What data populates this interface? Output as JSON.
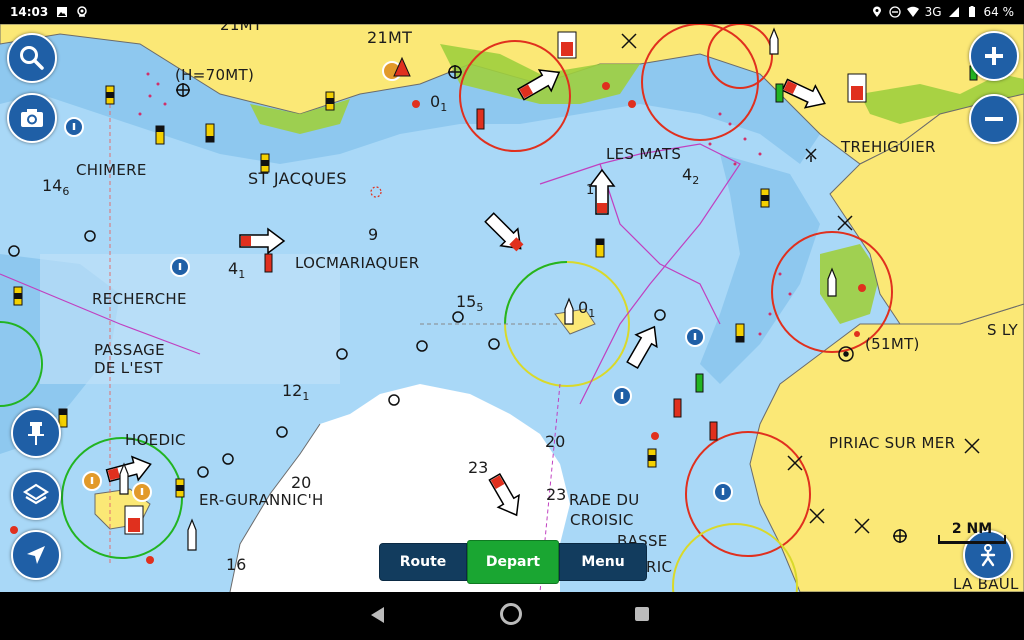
{
  "status_bar": {
    "time": "14:03",
    "network": "3G",
    "battery": "64 %",
    "icons_left": [
      "image-icon",
      "location-pin-icon"
    ],
    "icons_right": [
      "location-icon",
      "do-not-disturb-icon",
      "wifi-icon",
      "signal-icon",
      "battery-icon"
    ]
  },
  "map": {
    "place_labels": {
      "top_partial": "21MT",
      "mt21": "21MT",
      "h70": "(H=70MT)",
      "chimere": "CHIMERE",
      "st_jacques": "ST JACQUES",
      "les_mats": "LES MATS",
      "trehiguier": "TREHIGUIER",
      "locmariaquer": "LOCMARIAQUER",
      "recherche": "RECHERCHE",
      "passage_line1": "PASSAGE",
      "passage_line2": "DE L'EST",
      "s_ly": "S LY",
      "mt51": "(51MT)",
      "hoedic": "HOEDIC",
      "er_gurannic": "ER-GURANNIC'H",
      "piriac": "PIRIAC SUR MER",
      "rade_line1": "RADE DU",
      "rade_line2": "CROISIC",
      "basse": "BASSE",
      "basse_ric": "RIC",
      "la_baule": "LA BAUL"
    },
    "depths": {
      "d14": {
        "main": "14",
        "sub": "6"
      },
      "d4": {
        "main": "4",
        "sub": "1"
      },
      "d9": {
        "main": "9",
        "sub": ""
      },
      "d15": {
        "main": "15",
        "sub": "5"
      },
      "d12": {
        "main": "12",
        "sub": "1"
      },
      "d20a": {
        "main": "20",
        "sub": ""
      },
      "d20b": {
        "main": "20",
        "sub": ""
      },
      "d23a": {
        "main": "23",
        "sub": ""
      },
      "d23b": {
        "main": "23",
        "sub": ""
      },
      "d16": {
        "main": "16",
        "sub": ""
      },
      "d0a": {
        "main": "0",
        "sub": "1"
      },
      "d0b": {
        "main": "0",
        "sub": "1"
      },
      "d4b": {
        "main": "4",
        "sub": "2"
      },
      "d1": {
        "main": "1",
        "sub": ""
      }
    },
    "colors": {
      "land": "#fbe876",
      "shallow": "#8ec8ef",
      "medium": "#a9d8f7",
      "deep": "#c9e8fb",
      "drying": "#9fcf3e",
      "coast": "#6b6b6b"
    }
  },
  "controls": {
    "zoom_in_icon": "plus-icon",
    "zoom_out_icon": "minus-icon",
    "search_icon": "search-icon",
    "screenshot_icon": "camera-icon",
    "pin_icon": "pin-icon",
    "layers_icon": "layers-icon",
    "locate_icon": "navigation-arrow-icon",
    "person_icon": "person-icon"
  },
  "bottom_menu": {
    "route": "Route",
    "depart": "Depart",
    "menu": "Menu"
  },
  "scale": {
    "label": "2 NM"
  },
  "nav_bar": {
    "icons": [
      "back-icon",
      "home-icon",
      "recents-icon"
    ]
  }
}
